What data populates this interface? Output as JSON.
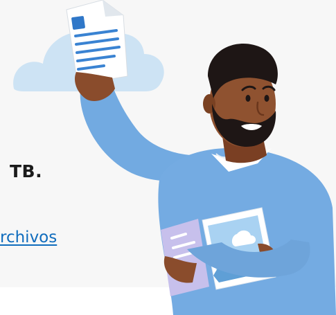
{
  "promo": {
    "storage_text": "TB.",
    "files_link_text": "rchivos"
  },
  "illustration": {
    "description_icon": "person-holding-document-icon",
    "cloud_icon": "cloud-icon",
    "document_icon": "document-icon",
    "photo_icon": "photo-icon"
  },
  "colors": {
    "link": "#0f6cbd",
    "sweater": "#6fa6de",
    "cloud": "#cfe4f5",
    "background": "#f7f7f7"
  }
}
